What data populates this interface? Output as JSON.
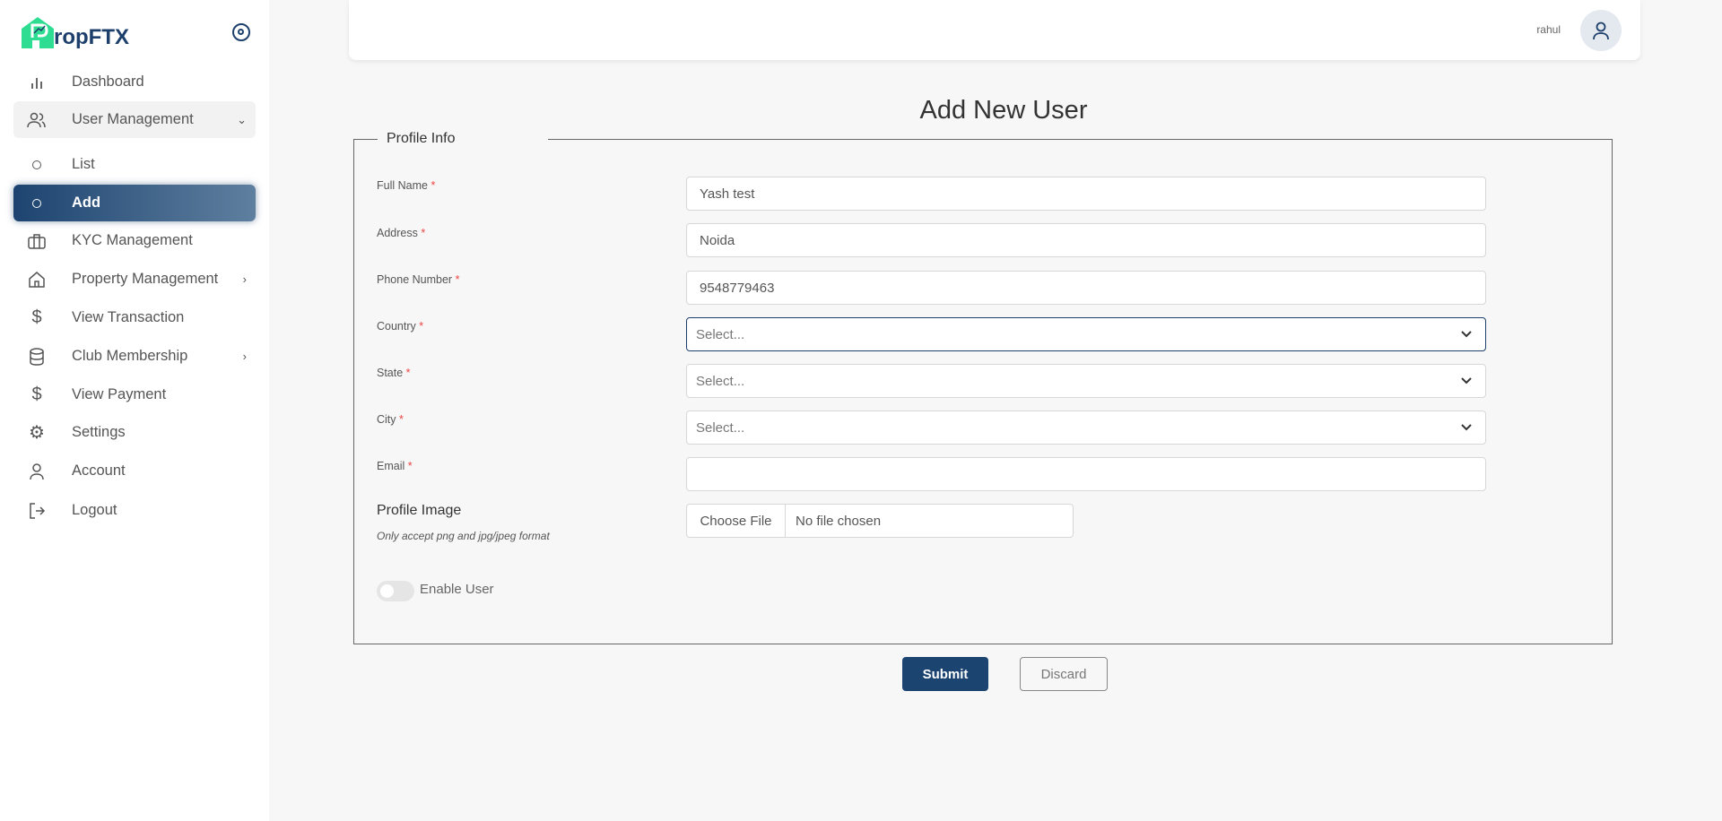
{
  "brand": {
    "name": "ropFTX",
    "logo_letter": "P",
    "accent": "#2fdd92",
    "primary": "#1d3f6b"
  },
  "sidebar": {
    "items": [
      {
        "label": "Dashboard",
        "icon": "bar-chart-icon"
      },
      {
        "label": "User Management",
        "icon": "users-icon",
        "chevron": "down"
      },
      {
        "label": "List",
        "icon": "circle-icon"
      },
      {
        "label": "Add",
        "icon": "circle-icon",
        "active": true
      },
      {
        "label": "KYC Management",
        "icon": "briefcase-icon"
      },
      {
        "label": "Property Management",
        "icon": "home-icon",
        "chevron": "right"
      },
      {
        "label": "View Transaction",
        "icon": "dollar-icon"
      },
      {
        "label": "Club Membership",
        "icon": "database-icon",
        "chevron": "right"
      },
      {
        "label": "View Payment",
        "icon": "dollar-icon"
      },
      {
        "label": "Settings",
        "icon": "gear-icon"
      },
      {
        "label": "Account",
        "icon": "user-icon"
      },
      {
        "label": "Logout",
        "icon": "logout-icon"
      }
    ]
  },
  "header": {
    "username": "rahul"
  },
  "page": {
    "title": "Add New User",
    "legend": "Profile Info"
  },
  "form": {
    "full_name": {
      "label": "Full Name",
      "value": "Yash test"
    },
    "address": {
      "label": "Address",
      "value": "Noida"
    },
    "phone": {
      "label": "Phone Number",
      "value": "9548779463"
    },
    "country": {
      "label": "Country",
      "placeholder": "Select..."
    },
    "state": {
      "label": "State",
      "placeholder": "Select..."
    },
    "city": {
      "label": "City",
      "placeholder": "Select..."
    },
    "email": {
      "label": "Email",
      "value": ""
    },
    "required_mark": "*",
    "profile_image": {
      "label": "Profile Image",
      "hint": "Only accept png and jpg/jpeg format",
      "button": "Choose File",
      "status": "No file chosen"
    },
    "enable_user": {
      "label": "Enable User",
      "on": false
    }
  },
  "actions": {
    "submit": "Submit",
    "discard": "Discard"
  }
}
